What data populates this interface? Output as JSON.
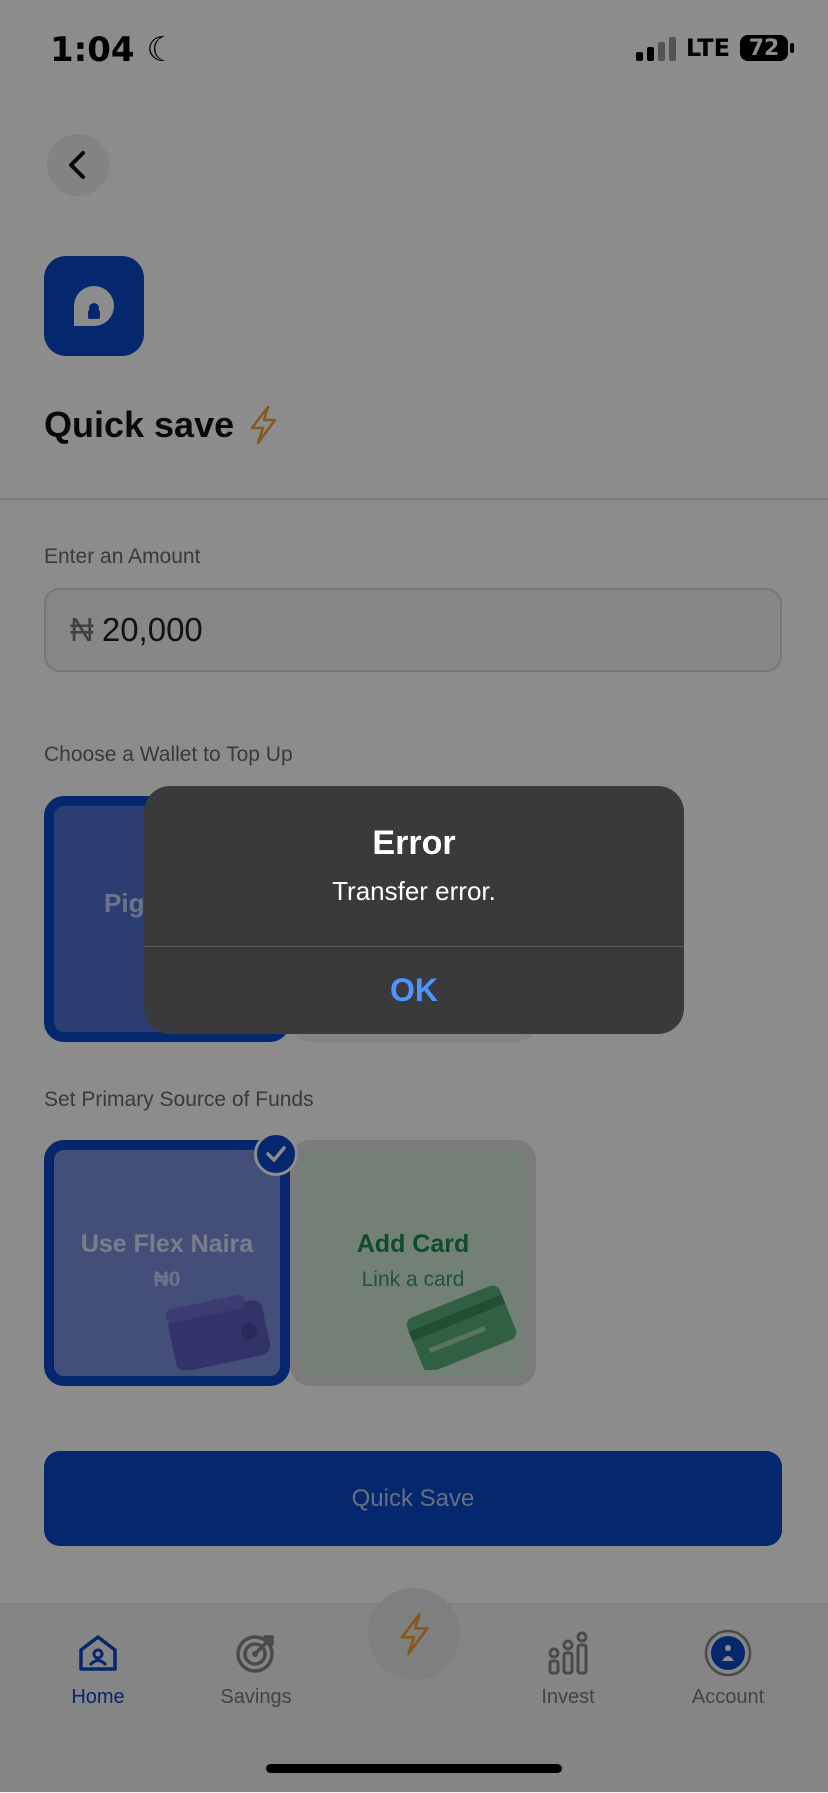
{
  "status_bar": {
    "time": "1:04",
    "network": "LTE",
    "battery": "72"
  },
  "header": {
    "title": "Quick save"
  },
  "amount": {
    "label": "Enter an Amount",
    "currency": "₦",
    "value": "20,000"
  },
  "wallet_section": {
    "label": "Choose a Wallet to Top Up",
    "selected_partial_label": "Pig"
  },
  "funds_section": {
    "label": "Set Primary Source of Funds",
    "flex": {
      "title": "Use Flex Naira",
      "balance": "₦0"
    },
    "card": {
      "title": "Add Card",
      "subtitle": "Link a card"
    }
  },
  "primary_button": {
    "label": "Quick Save"
  },
  "tabs": [
    {
      "label": "Home",
      "icon": "home-icon",
      "active": true
    },
    {
      "label": "Savings",
      "icon": "target-icon",
      "active": false
    },
    {
      "label": "Invest",
      "icon": "invest-icon",
      "active": false
    },
    {
      "label": "Account",
      "icon": "account-icon",
      "active": false
    }
  ],
  "alert": {
    "title": "Error",
    "message": "Transfer error.",
    "button": "OK"
  },
  "colors": {
    "brand_blue": "#0a48c8",
    "ok_blue": "#4f95ff",
    "bolt": "#f0a23a",
    "card_green": "#1f8a4b"
  }
}
